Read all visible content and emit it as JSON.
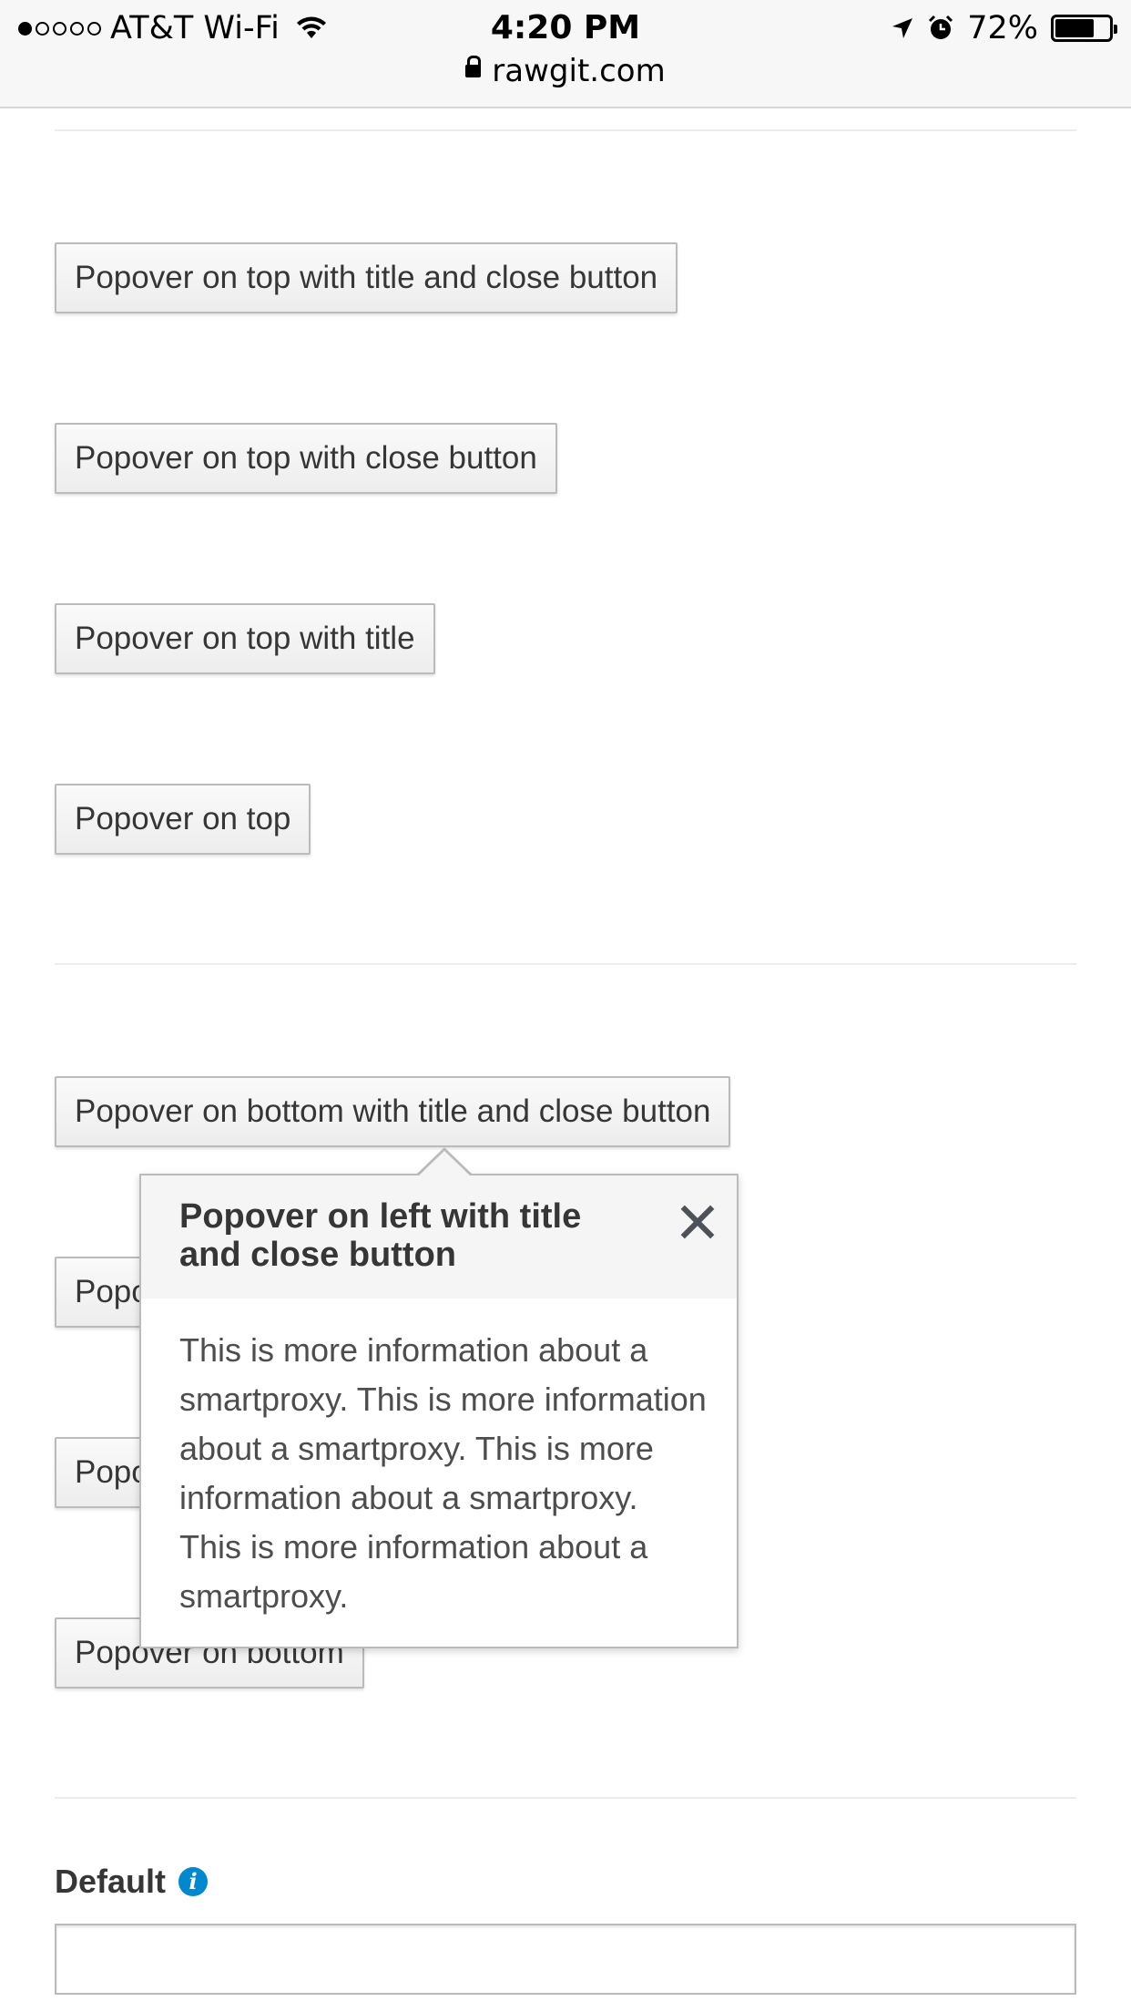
{
  "status_bar": {
    "carrier": "AT&T Wi-Fi",
    "signal_dots_filled": 1,
    "signal_dots_total": 5,
    "time": "4:20 PM",
    "battery_percent": "72%",
    "battery_level": 0.72,
    "url": "rawgit.com",
    "icons": [
      "wifi-icon",
      "location-arrow-icon",
      "alarm-icon",
      "battery-icon",
      "lock-icon"
    ]
  },
  "buttons": {
    "top_title_close": "Popover on top with title and close button",
    "top_close": "Popover on top with close button",
    "top_title": "Popover on top with title",
    "top": "Popover on top",
    "bottom_title_close": "Popover on bottom with title and close button",
    "bottom_close": "Popover on bottom with close button",
    "bottom_title": "Popover on bottom with title",
    "bottom": "Popover on bottom"
  },
  "popover": {
    "title": "Popover on left with title and close button",
    "body": "This is more information about a smartproxy. This is more information about a smartproxy. This is more information about a smartproxy. This is more information about a smartproxy."
  },
  "form": {
    "label": "Default",
    "input_value": "",
    "info_icon_glyph": "i"
  },
  "colors": {
    "info_icon": "#0088ce",
    "button_border": "#bbbbbb",
    "text": "#363636"
  }
}
